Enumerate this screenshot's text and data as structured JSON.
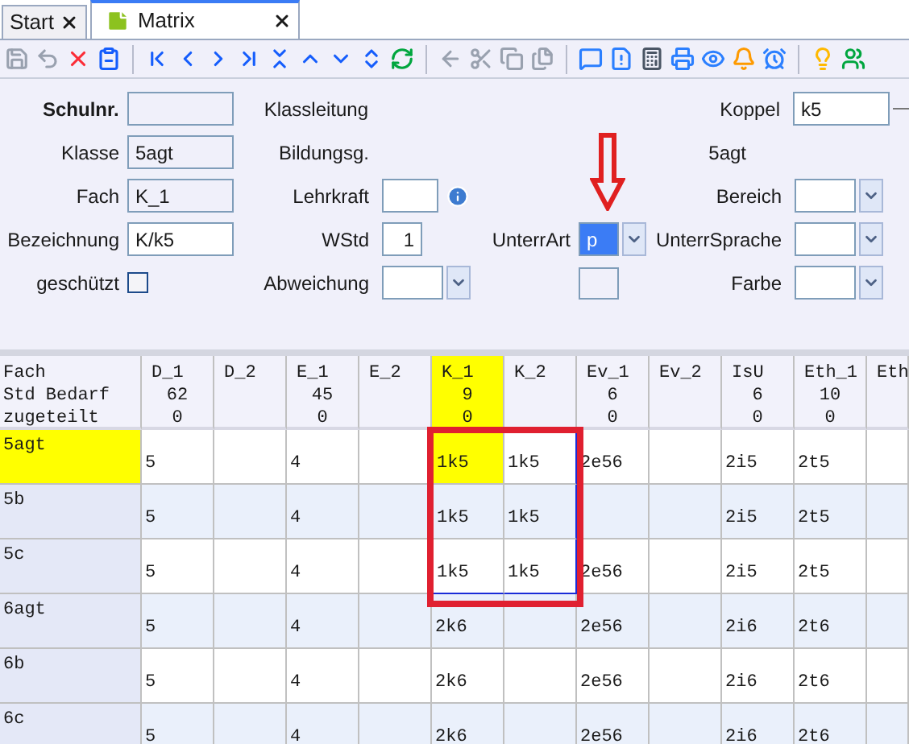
{
  "tabs": [
    {
      "label": "Start",
      "selected": false
    },
    {
      "label": "Matrix",
      "selected": true
    }
  ],
  "form_rows": [
    {
      "left": {
        "label": "Schulnr.",
        "bold": true,
        "field": {
          "kind": "text",
          "readonly": true
        }
      },
      "middle": {
        "label": "Klassleitung",
        "field": {
          "kind": "none"
        }
      },
      "unterr": {
        "field": {
          "kind": "none"
        }
      },
      "right": {
        "label": "Koppel",
        "field": {
          "kind": "text",
          "value": "k5",
          "readonly": false
        }
      }
    },
    {
      "left": {
        "label": "Klasse",
        "bold": false,
        "field": {
          "kind": "text",
          "value": "5agt",
          "readonly": true
        }
      },
      "middle": {
        "label": "Bildungsg.",
        "field": {
          "kind": "none"
        }
      },
      "unterr": {
        "field": {
          "kind": "none"
        }
      },
      "right": {
        "label": "5agt",
        "field": {
          "kind": "none"
        }
      }
    },
    {
      "left": {
        "label": "Fach",
        "bold": false,
        "field": {
          "kind": "text",
          "value": "K_1",
          "readonly": true
        }
      },
      "middle": {
        "label": "Lehrkraft",
        "field": {
          "kind": "info"
        }
      },
      "unterr": {
        "field": {
          "kind": "none"
        }
      },
      "right": {
        "label": "Bereich",
        "field": {
          "kind": "combo",
          "selected": false
        }
      }
    },
    {
      "left": {
        "label": "Bezeichnung",
        "bold": false,
        "field": {
          "kind": "text",
          "value": "K/k5",
          "readonly": false
        }
      },
      "middle": {
        "label": "WStd",
        "field": {
          "kind": "number",
          "value": "1"
        }
      },
      "unterr": {
        "label": "UnterrArt",
        "field": {
          "kind": "combo",
          "value": "p",
          "selected": true
        }
      },
      "right": {
        "label": "UnterrSprache",
        "field": {
          "kind": "combo",
          "selected": false
        }
      }
    },
    {
      "left": {
        "label": "geschützt",
        "bold": false,
        "field": {
          "kind": "checkbox",
          "checked": false
        }
      },
      "middle": {
        "label": "Abweichung",
        "field": {
          "kind": "combo",
          "selected": false
        }
      },
      "unterr": {
        "field": {
          "kind": "box"
        }
      },
      "right": {
        "label": "Farbe",
        "field": {
          "kind": "combo",
          "selected": false
        }
      }
    }
  ],
  "grid": {
    "header_labels": [
      "Fach",
      "Std Bedarf",
      "zugeteilt"
    ],
    "columns": [
      {
        "name": "D_1",
        "bedarf": "62",
        "zugeteilt": "0",
        "selected": false,
        "in_range": false
      },
      {
        "name": "D_2",
        "selected": false,
        "in_range": false
      },
      {
        "name": "E_1",
        "bedarf": "45",
        "zugeteilt": "0",
        "selected": false,
        "in_range": false
      },
      {
        "name": "E_2",
        "selected": false,
        "in_range": false
      },
      {
        "name": "K_1",
        "bedarf": "9",
        "zugeteilt": "0",
        "selected": true,
        "in_range": true
      },
      {
        "name": "K_2",
        "selected": false,
        "in_range": true
      },
      {
        "name": "Ev_1",
        "bedarf": "6",
        "zugeteilt": "0",
        "selected": false,
        "in_range": false
      },
      {
        "name": "Ev_2",
        "selected": false,
        "in_range": false
      },
      {
        "name": "IsU",
        "bedarf": "6",
        "zugeteilt": "0",
        "selected": false,
        "in_range": false
      },
      {
        "name": "Eth_1",
        "bedarf": "10",
        "zugeteilt": "0",
        "selected": false,
        "in_range": false
      },
      {
        "name": "Eth",
        "selected": false,
        "in_range": false
      }
    ],
    "rows": [
      {
        "label": "5agt",
        "selected": true,
        "in_range": true,
        "cells": [
          "5",
          "",
          "4",
          "",
          "1k5",
          "1k5",
          "2e56",
          "",
          "2i5",
          "2t5",
          ""
        ]
      },
      {
        "label": "5b",
        "selected": false,
        "in_range": true,
        "cells": [
          "5",
          "",
          "4",
          "",
          "1k5",
          "1k5",
          "",
          "",
          "2i5",
          "2t5",
          ""
        ]
      },
      {
        "label": "5c",
        "selected": false,
        "in_range": true,
        "cells": [
          "5",
          "",
          "4",
          "",
          "1k5",
          "1k5",
          "2e56",
          "",
          "2i5",
          "2t5",
          ""
        ]
      },
      {
        "label": "6agt",
        "selected": false,
        "in_range": false,
        "cells": [
          "5",
          "",
          "4",
          "",
          "2k6",
          "",
          "2e56",
          "",
          "2i6",
          "2t6",
          ""
        ]
      },
      {
        "label": "6b",
        "selected": false,
        "in_range": false,
        "cells": [
          "5",
          "",
          "4",
          "",
          "2k6",
          "",
          "2e56",
          "",
          "2i6",
          "2t6",
          ""
        ]
      },
      {
        "label": "6c",
        "selected": false,
        "in_range": false,
        "cells": [
          "5",
          "",
          "4",
          "",
          "2k6",
          "",
          "2e56",
          "",
          "2i6",
          "2t6",
          ""
        ]
      }
    ]
  }
}
